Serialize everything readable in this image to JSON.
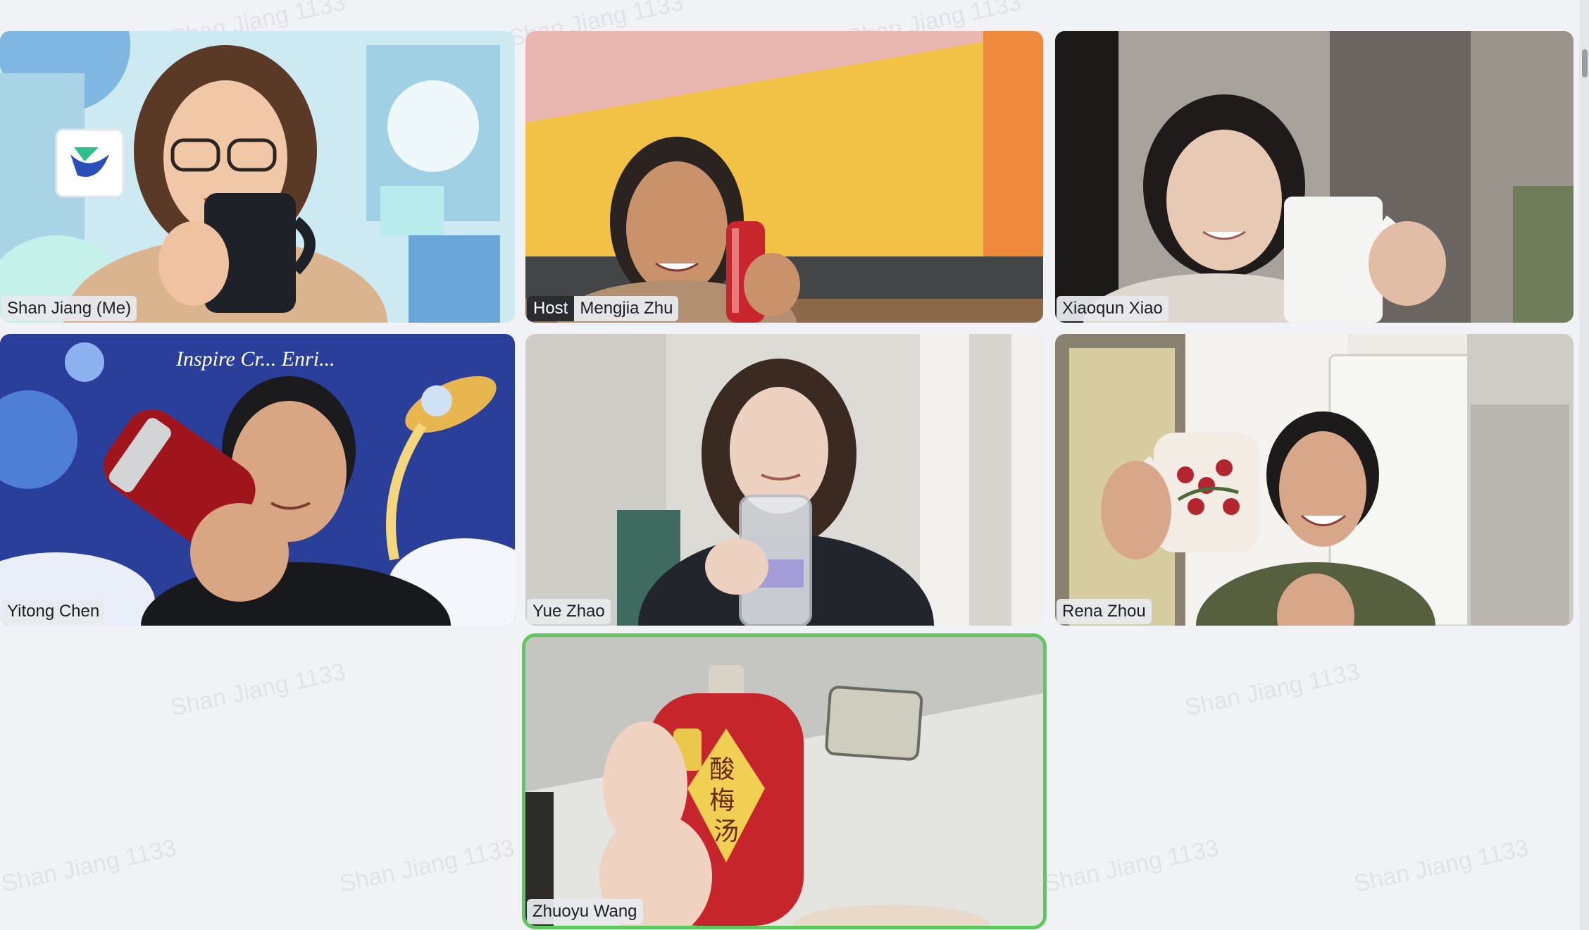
{
  "meeting": {
    "watermark_text": "Shan Jiang 1133",
    "host_badge": "Host",
    "participants": [
      {
        "name": "Shan Jiang (Me)",
        "is_host": false,
        "active_speaker": false
      },
      {
        "name": "Mengjia Zhu",
        "is_host": true,
        "active_speaker": false
      },
      {
        "name": "Xiaoqun Xiao",
        "is_host": false,
        "active_speaker": false
      },
      {
        "name": "Yitong Chen",
        "is_host": false,
        "active_speaker": false
      },
      {
        "name": "Yue Zhao",
        "is_host": false,
        "active_speaker": false
      },
      {
        "name": "Rena Zhou",
        "is_host": false,
        "active_speaker": false
      },
      {
        "name": "Zhuoyu Wang",
        "is_host": false,
        "active_speaker": true
      }
    ]
  },
  "video_captions": {
    "mug_print": "Inspire Creativity Enrich Life",
    "banner_text": "Inspire Cr... Enri...",
    "bottle_label": "酸梅汤"
  },
  "colors": {
    "background": "#f1f2f5",
    "active_speaker_border": "#5cc95c",
    "host_badge_bg": "#2a2c31",
    "name_tag_bg": "#e8e9ec"
  }
}
